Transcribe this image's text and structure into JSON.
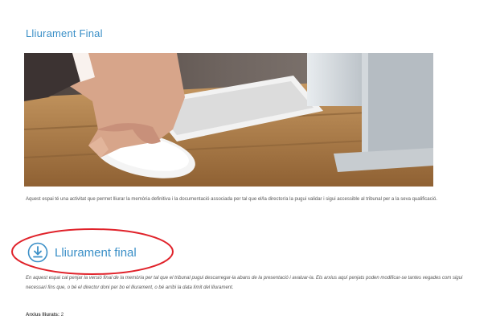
{
  "page": {
    "title": "Lliurament Final"
  },
  "hero": {
    "image_alt": "hand-on-mouse-photo"
  },
  "intro": {
    "text": "Aquest espai té una activitat que permet lliurar la memòria definitiva i la documentació associada per tal que el/la director/a la pugui validar i sigui accessible al tribunal per a la seva qualificació."
  },
  "section": {
    "icon": "download-icon",
    "title": "Lliurament final",
    "description": "En aquest espai cal penjar la versió final de la memòria per tal que el tribunal pugui descarregar-la abans de la presentació i avaluar-la. Els arxius aquí penjats poden modificar-se tantes vegades com sigui necessari fins que, o bé el director doni per bo el lliurament, o bé arribi la data límit del lliurament.",
    "files_label": "Arxius lliurats:",
    "files_count": "2"
  },
  "colors": {
    "accent": "#3a8fc7",
    "highlight": "#e0222a"
  }
}
